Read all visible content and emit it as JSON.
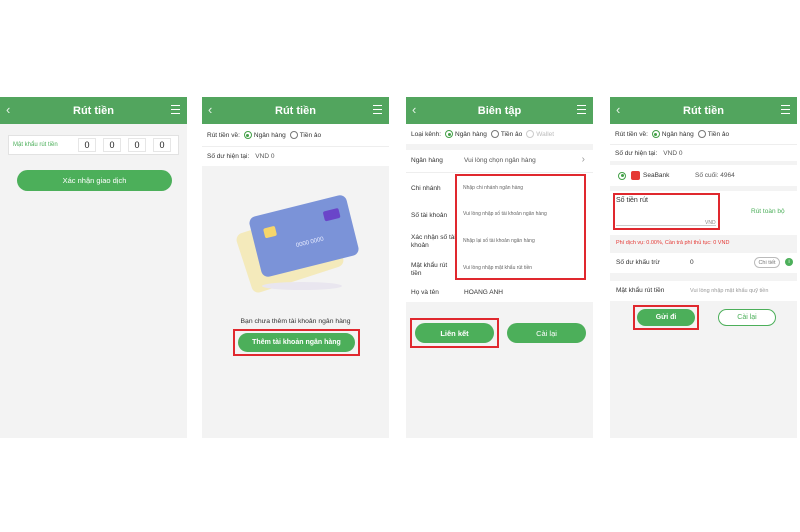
{
  "screen1": {
    "title": "Rút tiền",
    "password_label": "Mật khẩu rút tiền",
    "digits": [
      "0",
      "0",
      "0",
      "0"
    ],
    "confirm_button": "Xác nhận giao dịch"
  },
  "screen2": {
    "title": "Rút tiền",
    "withdraw_to_label": "Rút tiền về:",
    "option_bank": "Ngân hàng",
    "option_ewallet": "Tiền ảo",
    "balance_label": "Số dư hiện tại:",
    "balance_value": "VND 0",
    "card_number": "0000 0000",
    "empty_message": "Bạn chưa thêm tài khoản ngân hàng",
    "add_bank_button": "Thêm tài khoản ngân hàng"
  },
  "screen3": {
    "title": "Biên tập",
    "type_label": "Loại kênh:",
    "option_bank": "Ngân hàng",
    "option_ewallet": "Tiền ảo",
    "option_wallet": "Wallet",
    "fields": [
      {
        "label": "Ngân hàng",
        "placeholder": "Vui lòng chọn ngân hàng"
      },
      {
        "label": "Chi nhánh",
        "placeholder": "Nhập chi nhánh ngân hàng"
      },
      {
        "label": "Số tài khoản",
        "placeholder": "Vui lòng nhập số tài khoản ngân hàng"
      },
      {
        "label": "Xác nhận số tài khoản",
        "placeholder": "Nhập lại số tài khoản ngân hàng"
      },
      {
        "label": "Mật khẩu rút tiền",
        "placeholder": "Vui lòng nhập mật khẩu rút tiền"
      },
      {
        "label": "Họ và tên",
        "value": "HOANG ANH"
      }
    ],
    "link_button": "Liên kết",
    "reset_button": "Cài lại"
  },
  "screen4": {
    "title": "Rút tiền",
    "withdraw_to_label": "Rút tiền về:",
    "option_bank": "Ngân hàng",
    "option_ewallet": "Tiền ảo",
    "balance_label": "Số dư hiện tại:",
    "balance_value": "VND 0",
    "bank_name": "SeaBank",
    "last_digits": "Số cuối: 4964",
    "amount_label": "Số tiền rút",
    "amount_unit": "VND",
    "withdraw_all": "Rút toàn bộ",
    "fee_text": "Phí dịch vụ: 0.00%, Cần trả phí thủ tục: 0 VND",
    "deduct_label": "Số dư khấu trừ",
    "deduct_value": "0",
    "detail_button": "Chi tiết",
    "password_label": "Mật khẩu rút tiền",
    "password_placeholder": "Vui lòng nhập mật khẩu quỹ tiền",
    "send_button": "Gửi đi",
    "reset_button": "Cài lại"
  },
  "colors": {
    "accent": "#4caf5a",
    "header": "#52a55e",
    "highlight": "#e0282e",
    "warning": "#e53935"
  }
}
